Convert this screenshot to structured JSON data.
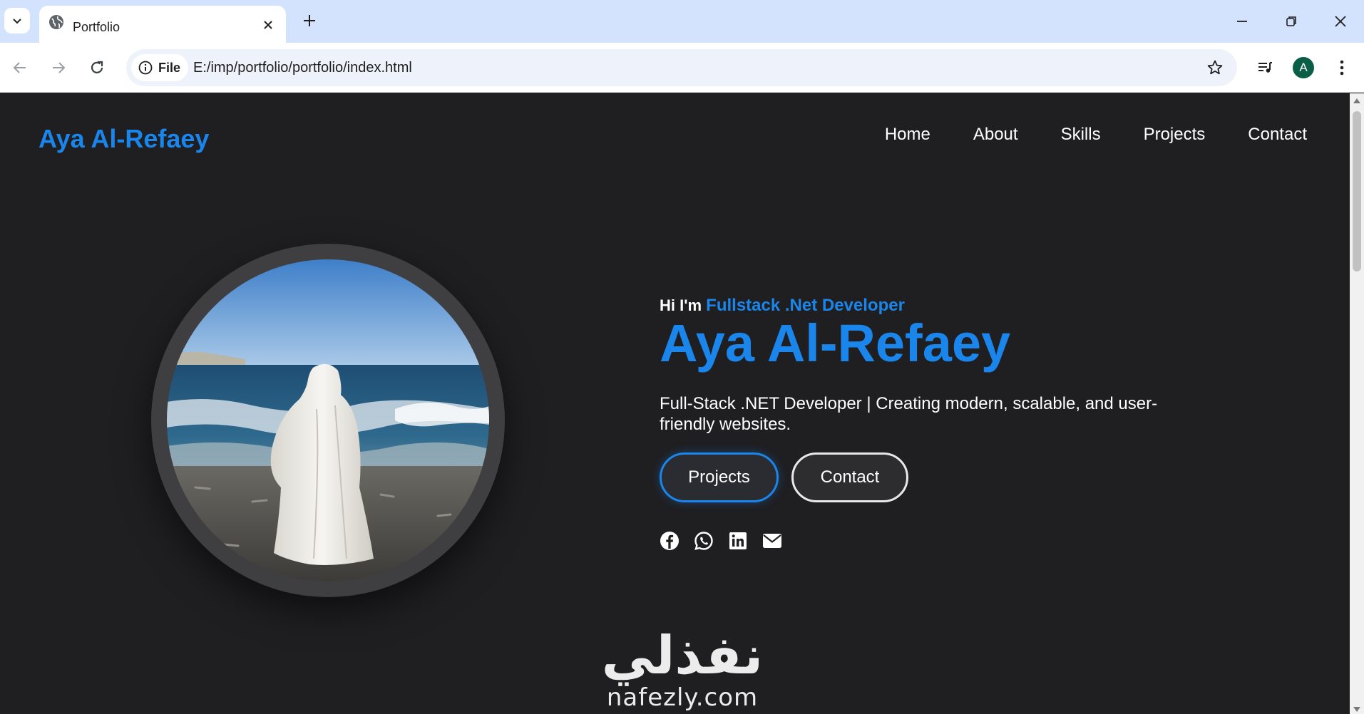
{
  "browser": {
    "tab_title": "Portfolio",
    "site_chip_label": "File",
    "url": "E:/imp/portfolio/portfolio/index.html",
    "profile_initial": "A"
  },
  "header": {
    "logo": "Aya Al-Refaey",
    "nav": [
      {
        "label": "Home"
      },
      {
        "label": "About"
      },
      {
        "label": "Skills"
      },
      {
        "label": "Projects"
      },
      {
        "label": "Contact"
      }
    ]
  },
  "hero": {
    "greeting": "Hi I'm",
    "role": "Fullstack .Net Developer",
    "name": "Aya Al-Refaey",
    "tagline": "Full-Stack .NET Developer | Creating modern, scalable, and user-friendly websites.",
    "buttons": {
      "projects": "Projects",
      "contact": "Contact"
    },
    "socials": [
      "facebook-icon",
      "whatsapp-icon",
      "linkedin-icon",
      "email-icon"
    ]
  },
  "watermark": {
    "arabic": "نفذلي",
    "latin": "nafezly.com"
  },
  "colors": {
    "accent": "#1a85ea",
    "page_bg": "#1f1f22",
    "tabstrip_bg": "#d3e3fd"
  }
}
